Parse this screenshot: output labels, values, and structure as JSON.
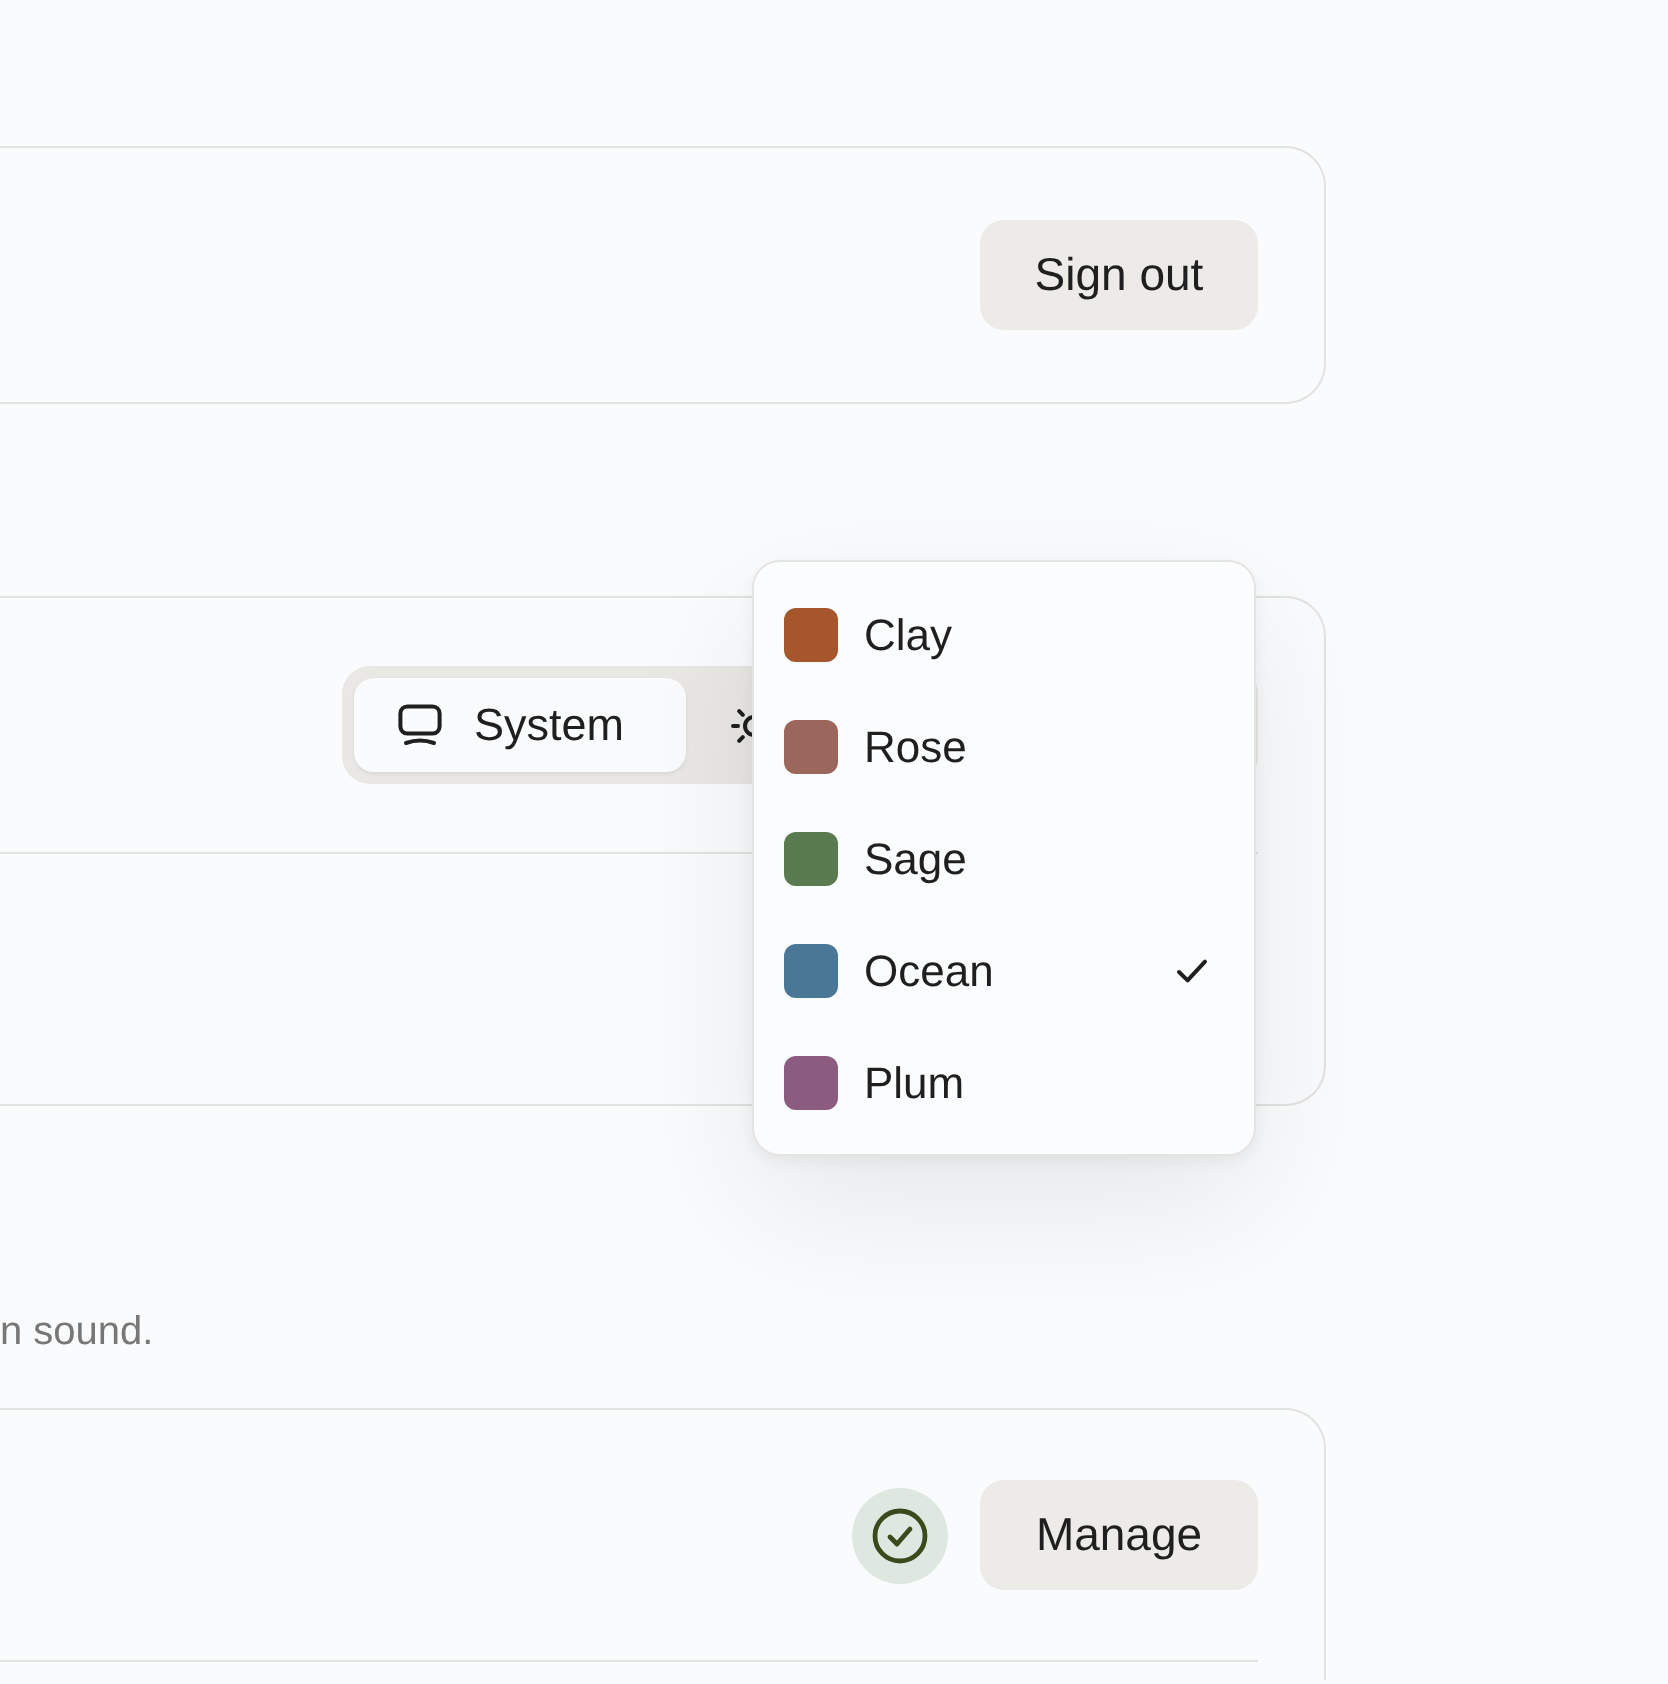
{
  "account": {
    "sign_out_button": "Sign out"
  },
  "appearance": {
    "theme_options": [
      {
        "kind": "system",
        "label": "System",
        "selected": true
      },
      {
        "kind": "light",
        "selected": false
      }
    ],
    "accent_menu": {
      "items": [
        {
          "label": "Clay",
          "color": "#a6562c",
          "selected": false
        },
        {
          "label": "Rose",
          "color": "#9b665c",
          "selected": false
        },
        {
          "label": "Sage",
          "color": "#5a7b4f",
          "selected": false
        },
        {
          "label": "Ocean",
          "color": "#4b7797",
          "selected": true
        },
        {
          "label": "Plum",
          "color": "#8b5c80",
          "selected": false
        }
      ]
    }
  },
  "sound_hint": "n sound.",
  "devices": {
    "verified": true,
    "manage_button": "Manage"
  }
}
